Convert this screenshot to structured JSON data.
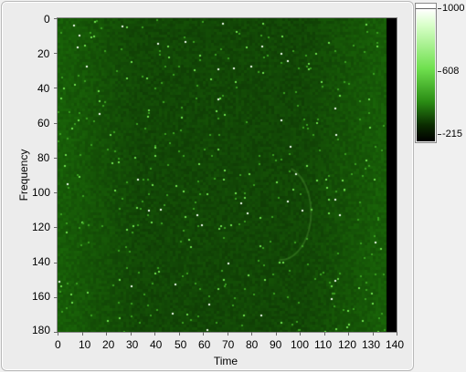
{
  "graph": {
    "xlabel": "Time",
    "ylabel": "Frequency",
    "x_ticks": [
      "0",
      "10",
      "20",
      "30",
      "40",
      "50",
      "60",
      "70",
      "80",
      "90",
      "100",
      "110",
      "120",
      "130",
      "140"
    ],
    "y_ticks": [
      "0",
      "20",
      "40",
      "60",
      "80",
      "100",
      "120",
      "140",
      "160",
      "180"
    ]
  },
  "colorbar": {
    "max_label": "1000",
    "mid_label": "608",
    "min_label": "-215",
    "colors": {
      "high": "#ffffff",
      "mid": "#6fe04e",
      "low": "#000000"
    }
  },
  "chart_data": {
    "type": "heatmap",
    "xlabel": "Time",
    "ylabel": "Frequency",
    "xlim": [
      0,
      140
    ],
    "ylim": [
      180,
      0
    ],
    "data_x_extent": [
      0,
      135
    ],
    "color_scale": {
      "min": -215,
      "max": 1000,
      "ticks": [
        1000,
        608,
        -215
      ]
    },
    "dominant_color": "#1f3f10",
    "background_color": "#000000"
  }
}
